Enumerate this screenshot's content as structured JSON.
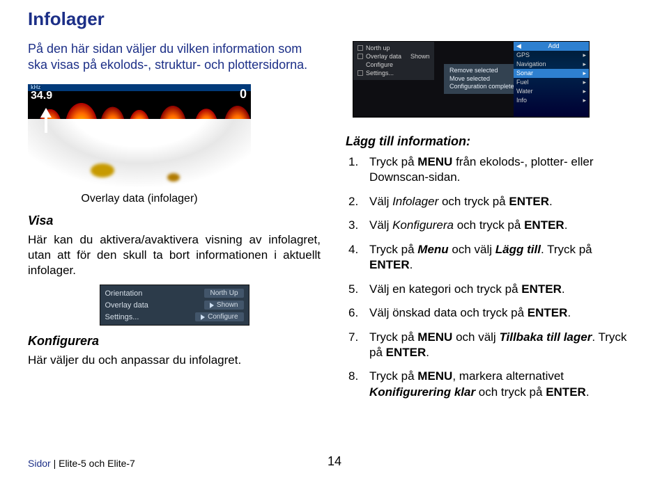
{
  "title": "Infolager",
  "intro": "På den här sidan väljer du vilken information som ska visas på ekolods-, struktur- och plottersidorna.",
  "sonar": {
    "depth": "34.9",
    "right": "0"
  },
  "caption": "Overlay data (infolager)",
  "visa": {
    "heading": "Visa",
    "text": "Här kan du aktivera/avaktivera visning av infolagret, utan att för den skull ta bort informationen i aktuellt infolager."
  },
  "ov": {
    "r1_label": "Orientation",
    "r1_val": "North Up",
    "r2_label": "Overlay data",
    "r2_val": "Shown",
    "r3_label": "Settings...",
    "r3_val": "Configure"
  },
  "konfig": {
    "heading": "Konfigurera",
    "text": "Här väljer du och anpassar du infolagret."
  },
  "win": {
    "tl1": "North up",
    "tl2": "Overlay data",
    "tl3": "Shown",
    "tl4": "Configure",
    "tl5": "Settings...",
    "mid1": "Remove selected",
    "mid2": "Move selected",
    "mid3": "Configuration complete",
    "rt_head": "Add",
    "rt_items": [
      "GPS",
      "Navigation",
      "Sonar",
      "Fuel",
      "Water",
      "Info"
    ]
  },
  "right_head": "Lägg till information:",
  "steps": {
    "s1a": "Tryck på ",
    "s1b": "MENU",
    "s1c": " från ekolods-, plotter- eller Downscan-sidan.",
    "s2a": "Välj ",
    "s2b": "Infolager",
    "s2c": "  och tryck på ",
    "s2d": "ENTER",
    "s2e": ".",
    "s3a": "Välj ",
    "s3b": "Konfigurera",
    "s3c": " och tryck på ",
    "s3d": "ENTER",
    "s3e": ".",
    "s4a": "Tryck på ",
    "s4b": "Menu",
    "s4c": " och välj ",
    "s4d": "Lägg till",
    "s4e": ". Tryck på ",
    "s4f": "ENTER",
    "s4g": ".",
    "s5a": "Välj en kategori och tryck på ",
    "s5b": "ENTER",
    "s5c": ".",
    "s6a": "Välj önskad data och tryck på ",
    "s6b": "ENTER",
    "s6c": ".",
    "s7a": "Tryck på ",
    "s7b": "MENU",
    "s7c": " och välj ",
    "s7d": "Tillbaka till lager",
    "s7e": ". Tryck på ",
    "s7f": "ENTER",
    "s7g": ".",
    "s8a": "Tryck på ",
    "s8b": "MENU",
    "s8c": ", markera alternativet ",
    "s8d": "Konifigurering klar",
    "s8e": " och tryck på ",
    "s8f": "ENTER",
    "s8g": "."
  },
  "footer": {
    "a": "Sidor",
    "b": " | Elite-5 och Elite-7"
  },
  "page": "14"
}
